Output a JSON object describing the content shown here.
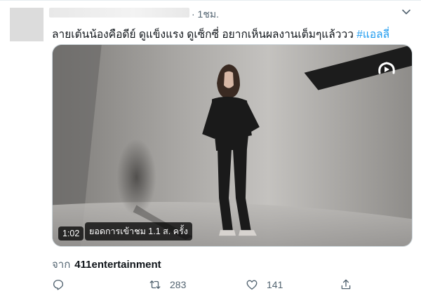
{
  "header": {
    "time": "· 1ชม."
  },
  "tweet": {
    "text": "ลายเต้นน้องคือดีย์ ดูแข็งแรง ดูเซ็กซี่ อยากเห็นผลงานเต็มๆแล้ววว ",
    "hashtag": "#แอลลี่"
  },
  "video": {
    "duration": "1:02",
    "views": "ยอดการเข้าชม 1.1 ส. ครั้ง"
  },
  "source": {
    "prefix": "จาก",
    "name": "411entertainment"
  },
  "actions": {
    "reply_count": "",
    "retweet_count": "283",
    "like_count": "141"
  }
}
